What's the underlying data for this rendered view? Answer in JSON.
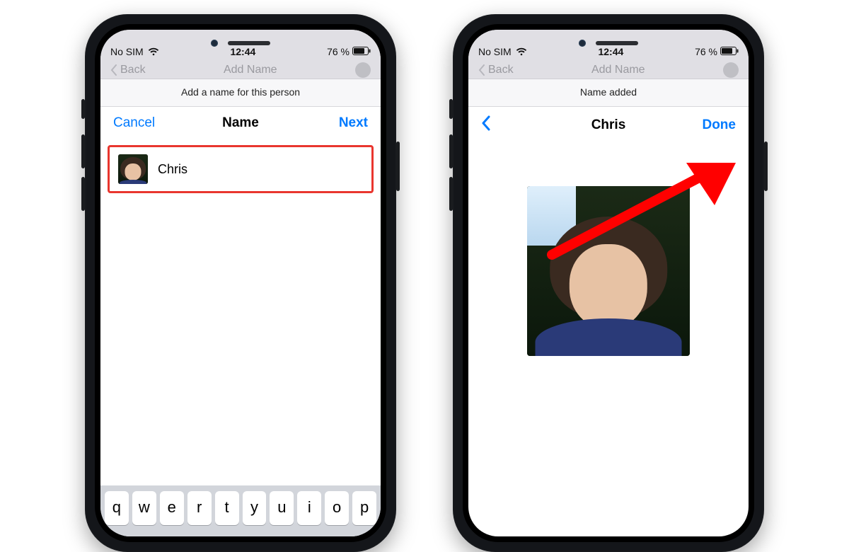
{
  "status": {
    "carrier": "No SIM",
    "time": "12:44",
    "battery": "76 %"
  },
  "behind_nav": {
    "back_label": "Back",
    "title": "Add Name"
  },
  "left": {
    "banner": "Add a name for this person",
    "cancel": "Cancel",
    "title": "Name",
    "next": "Next",
    "suggestion_name": "Chris"
  },
  "right": {
    "banner": "Name added",
    "title": "Chris",
    "done": "Done"
  },
  "keyboard_row": [
    "q",
    "w",
    "e",
    "r",
    "t",
    "y",
    "u",
    "i",
    "o",
    "p"
  ],
  "icons": {
    "wifi": "wifi-icon",
    "battery": "battery-icon",
    "chevron_left": "chevron-left-icon"
  },
  "colors": {
    "ios_blue": "#007aff",
    "highlight_red": "#e9362f"
  }
}
